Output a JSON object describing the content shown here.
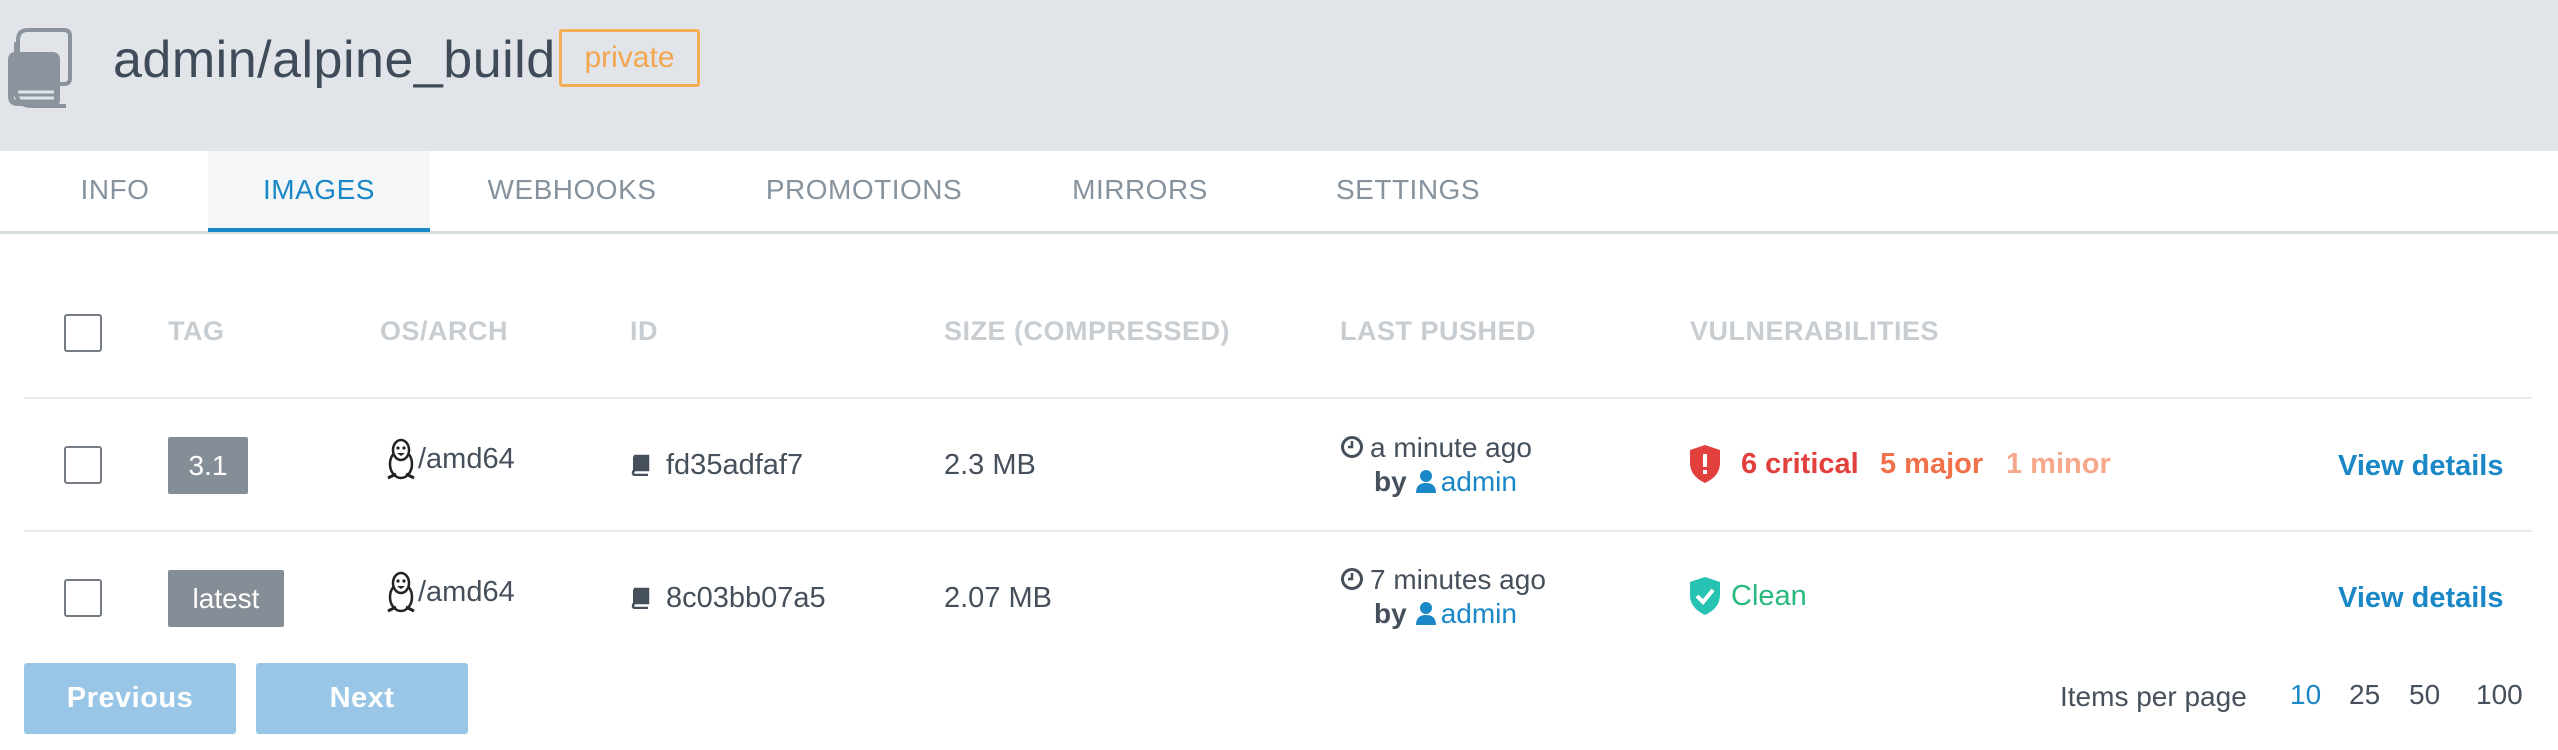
{
  "header": {
    "repo_name": "admin/alpine_build",
    "visibility": "private"
  },
  "tabs": [
    {
      "label": "INFO",
      "active": false
    },
    {
      "label": "IMAGES",
      "active": true
    },
    {
      "label": "WEBHOOKS",
      "active": false
    },
    {
      "label": "PROMOTIONS",
      "active": false
    },
    {
      "label": "MIRRORS",
      "active": false
    },
    {
      "label": "SETTINGS",
      "active": false
    }
  ],
  "table": {
    "columns": [
      "TAG",
      "OS/ARCH",
      "ID",
      "SIZE (COMPRESSED)",
      "LAST PUSHED",
      "VULNERABILITIES"
    ],
    "rows": [
      {
        "tag": "3.1",
        "arch": "/amd64",
        "id": "fd35adfaf7",
        "size": "2.3 MB",
        "pushed": "a minute ago",
        "by": "by",
        "user": "admin",
        "vuln_critical": "6 critical",
        "vuln_major": "5 major",
        "vuln_minor": "1 minor",
        "action": "View details"
      },
      {
        "tag": "latest",
        "arch": "/amd64",
        "id": "8c03bb07a5",
        "size": "2.07 MB",
        "pushed": "7 minutes ago",
        "by": "by",
        "user": "admin",
        "vuln_status": "Clean",
        "action": "View details"
      }
    ]
  },
  "pagination": {
    "previous": "Previous",
    "next": "Next",
    "items_per_page_label": "Items per page",
    "options": [
      "10",
      "25",
      "50",
      "100"
    ],
    "selected": "10"
  },
  "colors": {
    "accent": "#1a87c6",
    "critical": "#e2403d",
    "major": "#f0714a",
    "minor": "#f5a98a",
    "clean": "#27b97d",
    "private_badge": "#f5ad58"
  },
  "icons": [
    "repository-icon",
    "linux-icon",
    "image-id-icon",
    "clock-icon",
    "user-icon",
    "shield-alert-icon",
    "shield-check-icon"
  ]
}
